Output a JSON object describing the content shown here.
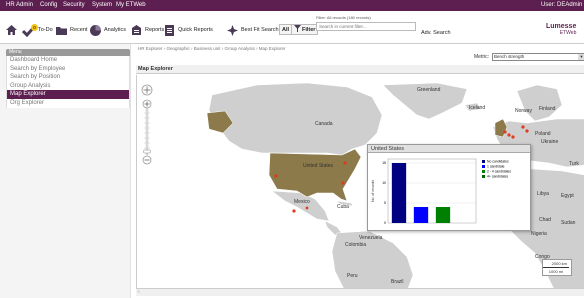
{
  "menubar": {
    "items": [
      "HR Admin",
      "Config",
      "Security",
      "System",
      "My ETWeb"
    ],
    "user": "User: DEAdmin"
  },
  "toolbar": {
    "todo_label": "To-Do",
    "todo_badge": "0",
    "recent_label": "Recent",
    "analytics_label": "Analytics",
    "reports_label": "Reports",
    "quick_reports_label": "Quick Reports",
    "best_fit_label": "Best Fit Search",
    "all_label": "All",
    "filter_label": "Filter",
    "filter_status": "Filter: All records (180 records)",
    "search_placeholder": "Search in current filter...",
    "adv_search_label": "Adv. Search",
    "brand": "Lumesse",
    "brand_sub": "ETWeb"
  },
  "sidebar": {
    "header": "Menu",
    "items": [
      {
        "label": "Dashboard Home",
        "active": false
      },
      {
        "label": "Search by Employee",
        "active": false
      },
      {
        "label": "Search by Position",
        "active": false
      },
      {
        "label": "Group Analysis",
        "active": false
      },
      {
        "label": "Map Explorer",
        "active": true
      },
      {
        "label": "Org Explorer",
        "active": false
      }
    ]
  },
  "breadcrumb": "HR Explorer  ›  Geographic  ›  Business unit  ›  Group Analysis  ›  Map Explorer",
  "metric": {
    "label": "Metric:",
    "value": "Bench strength"
  },
  "panel": {
    "title": "Map Explorer"
  },
  "map": {
    "labels": {
      "greenland": "Greenland",
      "iceland": "Iceland",
      "norway": "Norway",
      "finland": "Finland",
      "poland": "Poland",
      "ukraine": "Ukraine",
      "canada": "Canada",
      "us": "United States",
      "mexico": "Mexico",
      "cuba": "Cuba",
      "venezuela": "Venezuela",
      "colombia": "Colombia",
      "peru": "Peru",
      "brazil": "Brazil",
      "libya": "Libya",
      "egypt": "Egypt",
      "chad": "Chad",
      "sudan": "Sudan",
      "congo": "Congo",
      "nigeria": "Nigeria",
      "turkey": "Turk"
    },
    "colors": {
      "water": "#ffffff",
      "land": "#cfcfcf",
      "highlight": "#8c7a4b",
      "marker": "#e03a1e"
    },
    "scale_km": "2000 km",
    "scale_mi": "1000 mi"
  },
  "popup": {
    "title": "United States",
    "ylabel": "No. of records",
    "chart_data": {
      "type": "bar",
      "categories": [
        "No candidates",
        "1 candidate",
        "2 - 4 candidates",
        "4+ candidates"
      ],
      "values": [
        15,
        4,
        4,
        0
      ],
      "colors": [
        "#000080",
        "#0000ff",
        "#008000",
        "#006400"
      ],
      "yticks": [
        0,
        5,
        10,
        15
      ],
      "ylim": [
        0,
        16
      ]
    },
    "legend": [
      "No candidates",
      "1 candidate",
      "2 - 4 candidates",
      "4+ candidates"
    ]
  }
}
